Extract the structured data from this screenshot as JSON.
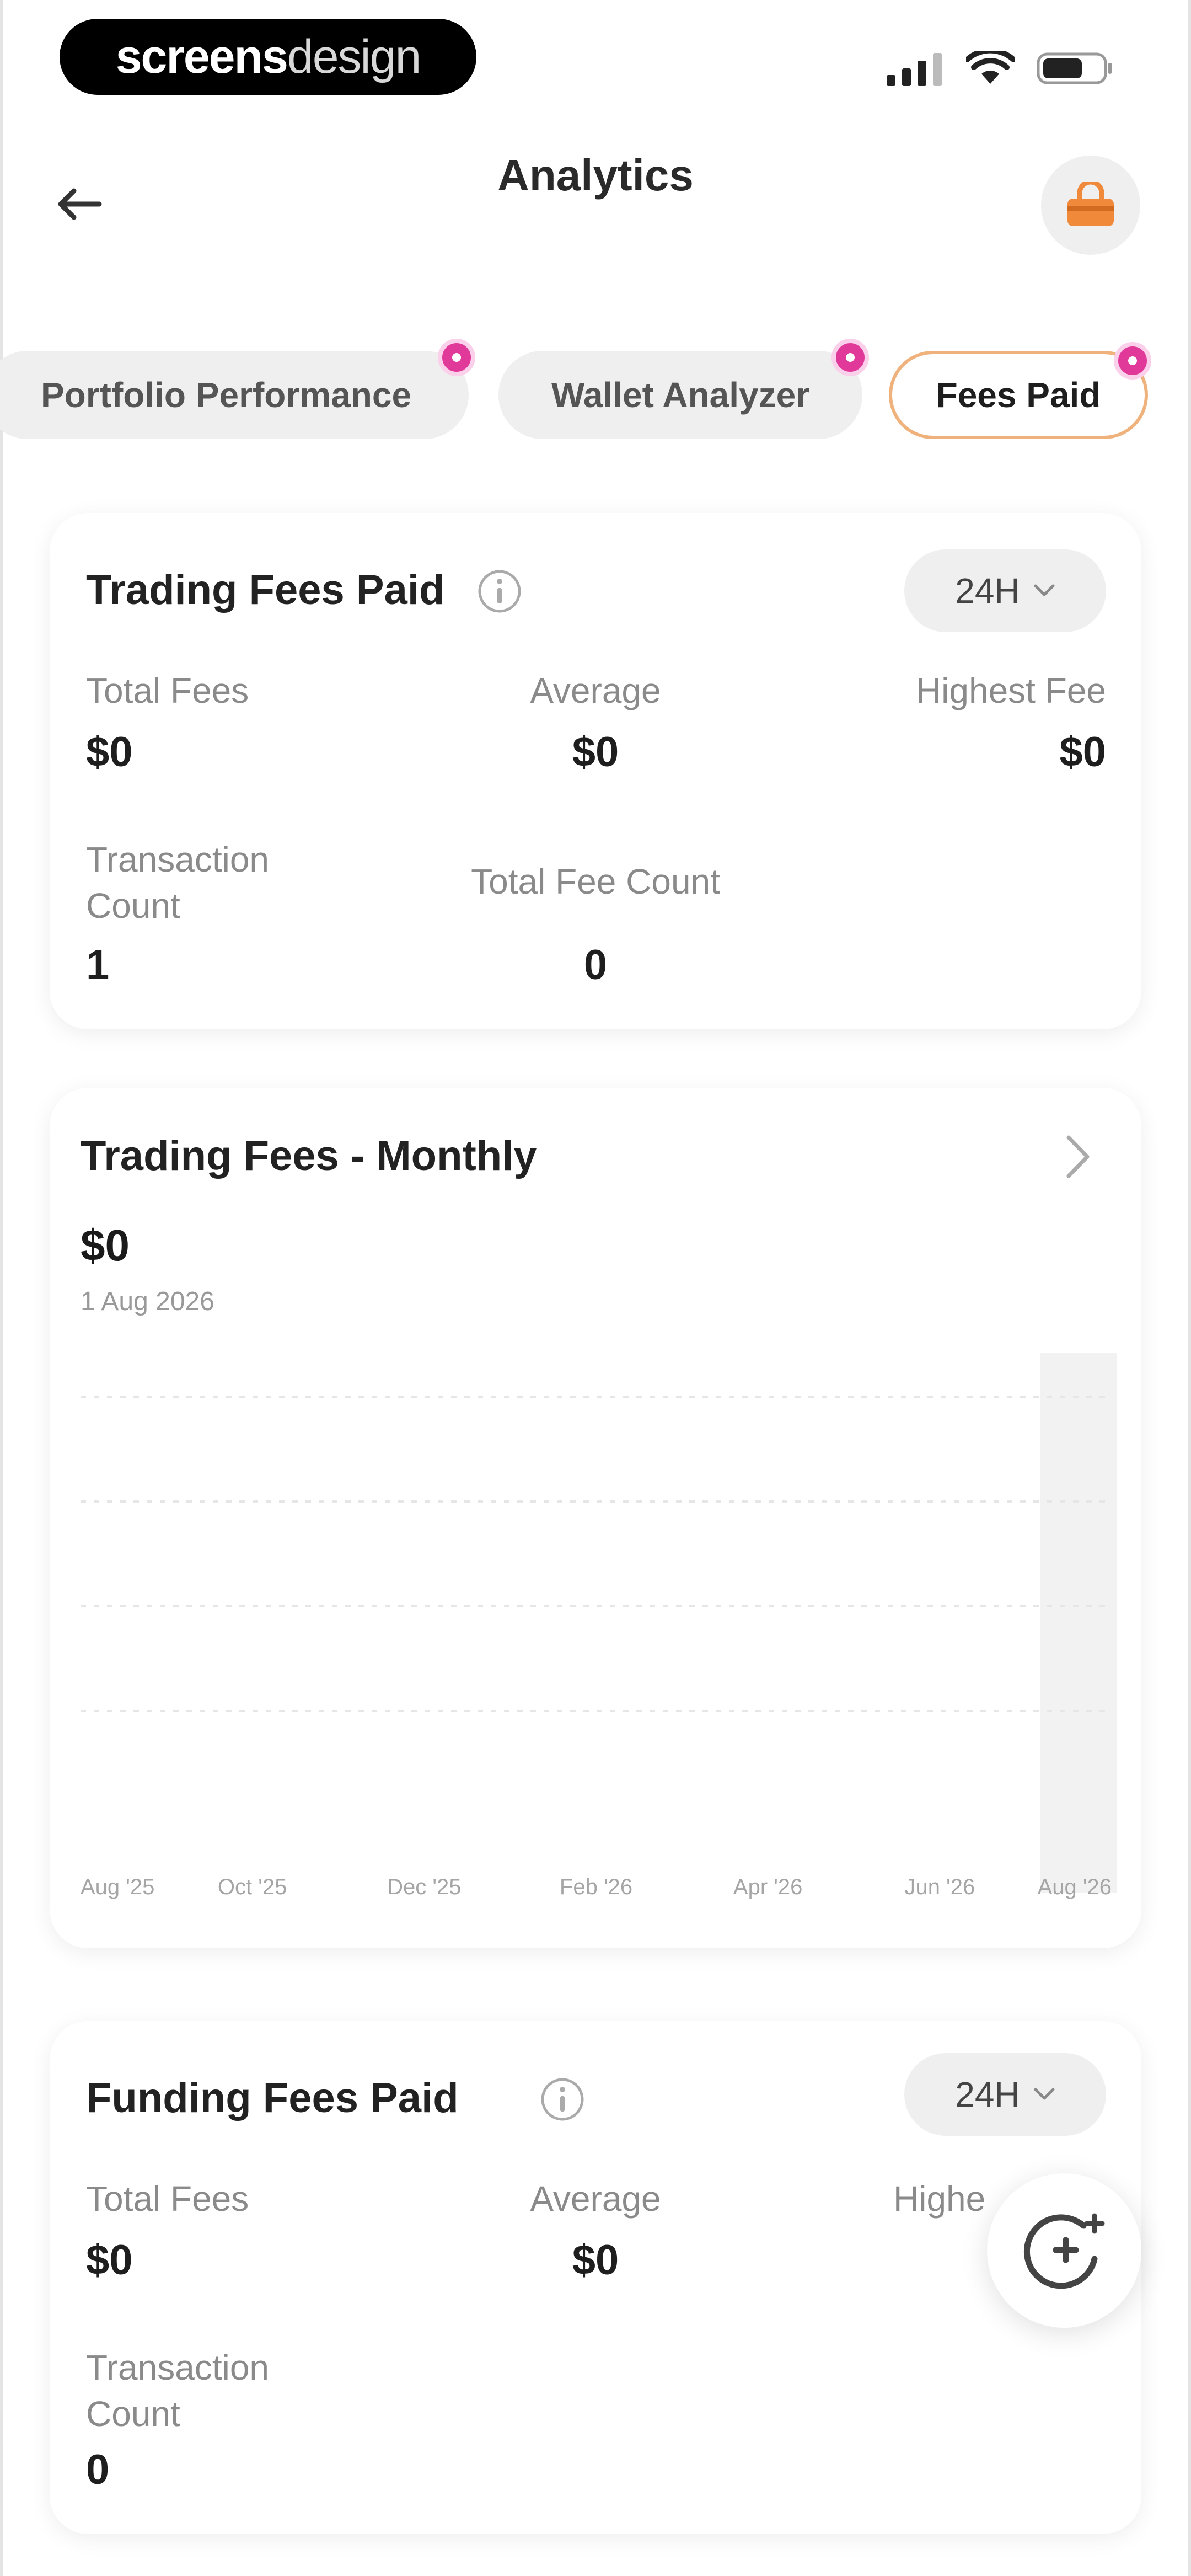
{
  "status_bar": {
    "brand_part1": "screens",
    "brand_part2": "design",
    "icons": [
      "signal-icon",
      "wifi-icon",
      "battery-icon"
    ]
  },
  "header": {
    "title": "Analytics",
    "back_icon": "arrow-left-icon",
    "avatar_icon": "shopping-bag-icon"
  },
  "tabs": [
    {
      "label": "Portfolio Performance",
      "active": false,
      "badge": true
    },
    {
      "label": "Wallet Analyzer",
      "active": false,
      "badge": true
    },
    {
      "label": "Fees Paid",
      "active": true,
      "badge": true
    }
  ],
  "trading_fees": {
    "title": "Trading Fees Paid",
    "period": "24H",
    "total_fees_label": "Total Fees",
    "total_fees_value": "$0",
    "average_label": "Average",
    "average_value": "$0",
    "highest_label": "Highest Fee",
    "highest_value": "$0",
    "tx_count_label": "Transaction Count",
    "tx_count_value": "1",
    "fee_count_label": "Total Fee Count",
    "fee_count_value": "0"
  },
  "monthly": {
    "title": "Trading Fees - Monthly",
    "amount": "$0",
    "date": "1 Aug 2026"
  },
  "chart_data": {
    "type": "bar",
    "categories": [
      "Aug '25",
      "Oct '25",
      "Dec '25",
      "Feb '26",
      "Apr '26",
      "Jun '26",
      "Aug '26"
    ],
    "values": [
      0,
      0,
      0,
      0,
      0,
      0,
      0
    ],
    "title": "Trading Fees - Monthly",
    "xlabel": "",
    "ylabel": "",
    "grid": true,
    "highlight_color": "#f2f2f2"
  },
  "funding_fees": {
    "title": "Funding Fees Paid",
    "period": "24H",
    "total_fees_label": "Total Fees",
    "total_fees_value": "$0",
    "average_label": "Average",
    "average_value": "$0",
    "highest_label": "Highe",
    "tx_count_label": "Transaction Count",
    "tx_count_value": "0"
  },
  "colors": {
    "accent_border": "#f0b27c",
    "badge": "#e0399a",
    "avatar_icon": "#f08a3a"
  }
}
